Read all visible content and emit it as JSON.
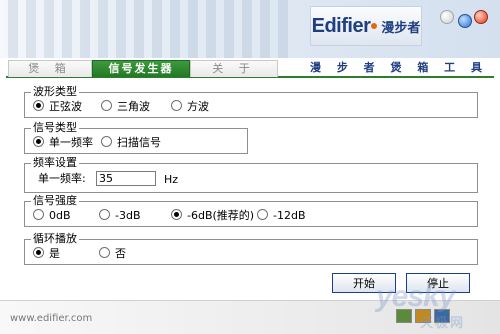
{
  "header": {
    "brand_name": "Edifier",
    "brand_cn": "漫步者",
    "tagline": "漫 步 者 煲 箱 工 具"
  },
  "tabs": [
    {
      "label": "煲 箱",
      "active": false
    },
    {
      "label": "信号发生器",
      "active": true
    },
    {
      "label": "关 于",
      "active": false
    }
  ],
  "waveform": {
    "title": "波形类型",
    "options": [
      "正弦波",
      "三角波",
      "方波"
    ],
    "selected": "正弦波"
  },
  "signal_type": {
    "title": "信号类型",
    "options": [
      "单一频率",
      "扫描信号"
    ],
    "selected": "单一频率"
  },
  "frequency": {
    "title": "频率设置",
    "label": "单一频率:",
    "value": "35",
    "unit": "Hz"
  },
  "strength": {
    "title": "信号强度",
    "options": [
      "0dB",
      "-3dB",
      "-6dB(推荐的)",
      "-12dB"
    ],
    "selected": "-6dB(推荐的)"
  },
  "loop": {
    "title": "循环播放",
    "options": [
      "是",
      "否"
    ],
    "selected": "是"
  },
  "buttons": {
    "start": "开始",
    "stop": "停止"
  },
  "footer": {
    "url": "www.edifier.com"
  },
  "watermark": {
    "latin": "yesky",
    "cn": "天极网"
  },
  "colors": {
    "brand": "#1f3f82",
    "active_tab": "#2f7b2f"
  }
}
